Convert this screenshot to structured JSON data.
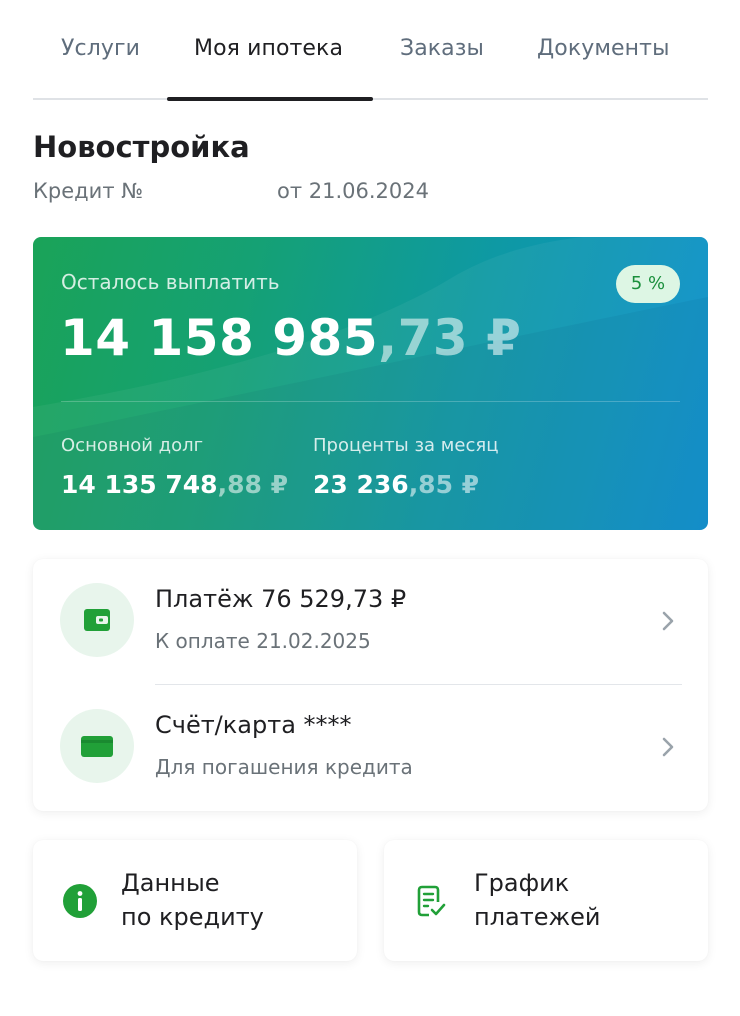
{
  "tabs": [
    {
      "label": "Услуги",
      "active": false
    },
    {
      "label": "Моя ипотека",
      "active": true
    },
    {
      "label": "Заказы",
      "active": false
    },
    {
      "label": "Документы",
      "active": false
    }
  ],
  "header": {
    "title": "Новостройка",
    "credit_label": "Кредит №",
    "credit_date": "от 21.06.2024"
  },
  "balance": {
    "label": "Осталось выплатить",
    "amount_int": "14 158 985",
    "amount_frac": ",73 ₽",
    "rate": "5 %",
    "principal_label": "Основной долг",
    "principal_int": "14 135 748",
    "principal_frac": ",88 ₽",
    "interest_label": "Проценты за месяц",
    "interest_int": "23 236",
    "interest_frac": ",85 ₽"
  },
  "payment": {
    "title": "Платёж 76 529,73 ₽",
    "subtitle": "К оплате 21.02.2025",
    "icon": "wallet-icon"
  },
  "account": {
    "title": "Счёт/карта ****",
    "subtitle": "Для погашения кредита",
    "icon": "card-icon"
  },
  "tiles": [
    {
      "line1": "Данные",
      "line2": "по кредиту",
      "icon": "info-icon"
    },
    {
      "line1": "График",
      "line2": "платежей",
      "icon": "schedule-icon"
    }
  ],
  "colors": {
    "accent": "#21a038",
    "card_gradient_start": "#1aa358",
    "card_gradient_end": "#0a8fcf",
    "badge_bg": "#ddf6e4"
  }
}
